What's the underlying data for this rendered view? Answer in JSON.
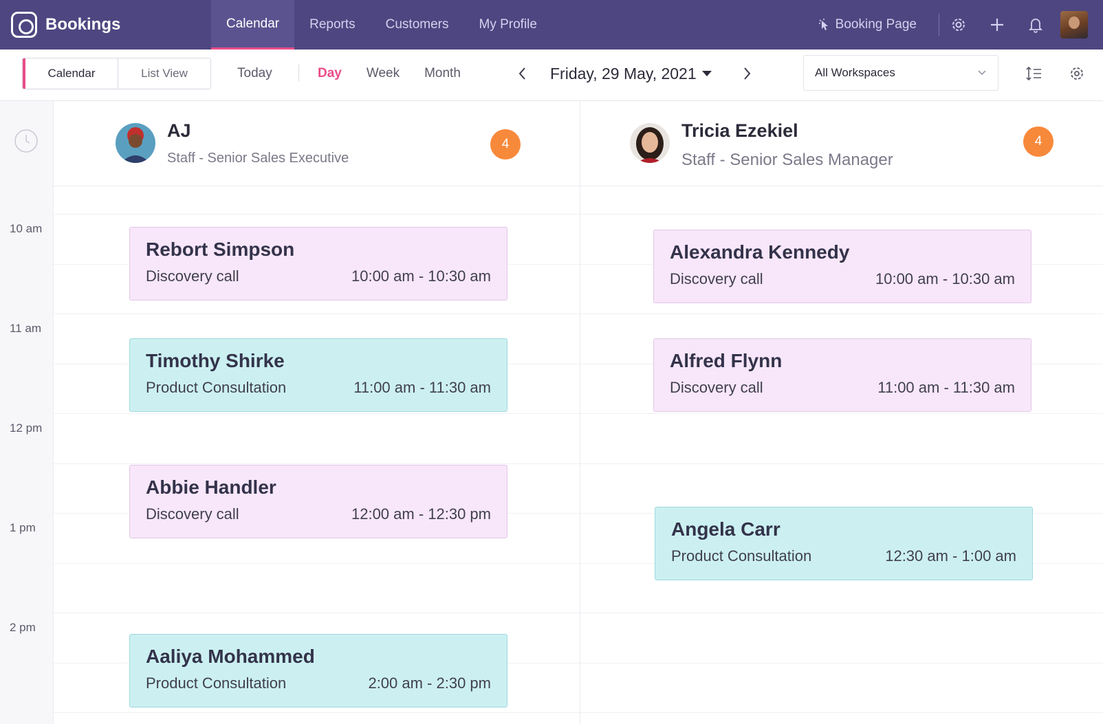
{
  "app": {
    "name": "Bookings",
    "brand_color": "#4e4680",
    "accent_color": "#ea4c89"
  },
  "topnav": {
    "tabs": [
      {
        "label": "Calendar",
        "active": true
      },
      {
        "label": "Reports",
        "active": false
      },
      {
        "label": "Customers",
        "active": false
      },
      {
        "label": "My Profile",
        "active": false
      }
    ],
    "booking_page_label": "Booking Page",
    "icons": [
      "cursor-icon",
      "gear-icon",
      "plus-icon",
      "bell-icon",
      "user-avatar"
    ]
  },
  "toolbar": {
    "view_options": [
      "Calendar",
      "List View"
    ],
    "active_view": "Calendar",
    "today_label": "Today",
    "ranges": [
      "Day",
      "Week",
      "Month"
    ],
    "active_range": "Day",
    "date_label": "Friday, 29 May, 2021",
    "workspace_selected": "All Workspaces"
  },
  "time_axis": {
    "hours": [
      "10 am",
      "11 am",
      "12 pm",
      "1 pm",
      "2 pm"
    ]
  },
  "staff": [
    {
      "name": "AJ",
      "role": "Staff - Senior Sales Executive",
      "count": "4",
      "appointments": [
        {
          "customer": "Rebort Simpson",
          "service": "Discovery call",
          "time": "10:00 am - 10:30 am",
          "color": "pink"
        },
        {
          "customer": "Timothy Shirke",
          "service": "Product Consultation",
          "time": "11:00 am - 11:30 am",
          "color": "teal"
        },
        {
          "customer": "Abbie Handler",
          "service": "Discovery call",
          "time": "12:00 am - 12:30 pm",
          "color": "pink"
        },
        {
          "customer": "Aaliya Mohammed",
          "service": "Product Consultation",
          "time": "2:00 am - 2:30 pm",
          "color": "teal"
        }
      ]
    },
    {
      "name": "Tricia Ezekiel",
      "role": "Staff - Senior Sales Manager",
      "count": "4",
      "appointments": [
        {
          "customer": "Alexandra Kennedy",
          "service": "Discovery call",
          "time": "10:00 am - 10:30 am",
          "color": "pink"
        },
        {
          "customer": "Alfred Flynn",
          "service": "Discovery call",
          "time": "11:00 am - 11:30 am",
          "color": "pink"
        },
        {
          "customer": "Angela Carr",
          "service": "Product Consultation",
          "time": "12:30 am - 1:00 am",
          "color": "teal"
        }
      ]
    }
  ]
}
